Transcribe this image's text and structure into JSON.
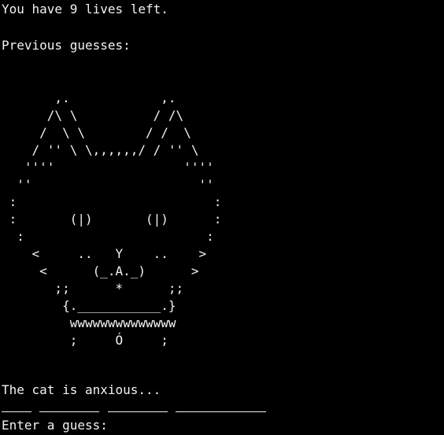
{
  "status": {
    "lives_text": "You have 9 lives left.",
    "previous_guesses_label": "Previous guesses:",
    "previous_guesses": ""
  },
  "cat_art": "       ,.            ,.\n      /\\ \\          / /\\\n     /  \\ \\        / /  \\\n    / '' \\ \\,,,,,,/ / '' \\\n   ''''                 ''''\n  ''                      ''\n :                          :\n :       (|)       (|)      :\n  :                        :\n    <     ..   Y    ..    >\n     <      (_.A._)      >\n       ;;      *      ;;\n        {.___________.}\n         wwwwwwwwwwwwww\n         ;     Ó     ;",
  "mood_text": "The cat is anxious...",
  "word_blanks": [
    4,
    8,
    8,
    12
  ],
  "input": {
    "prompt": "Enter a guess:",
    "value": ""
  },
  "colors": {
    "background": "#000000",
    "text": "#f2f2f2"
  }
}
